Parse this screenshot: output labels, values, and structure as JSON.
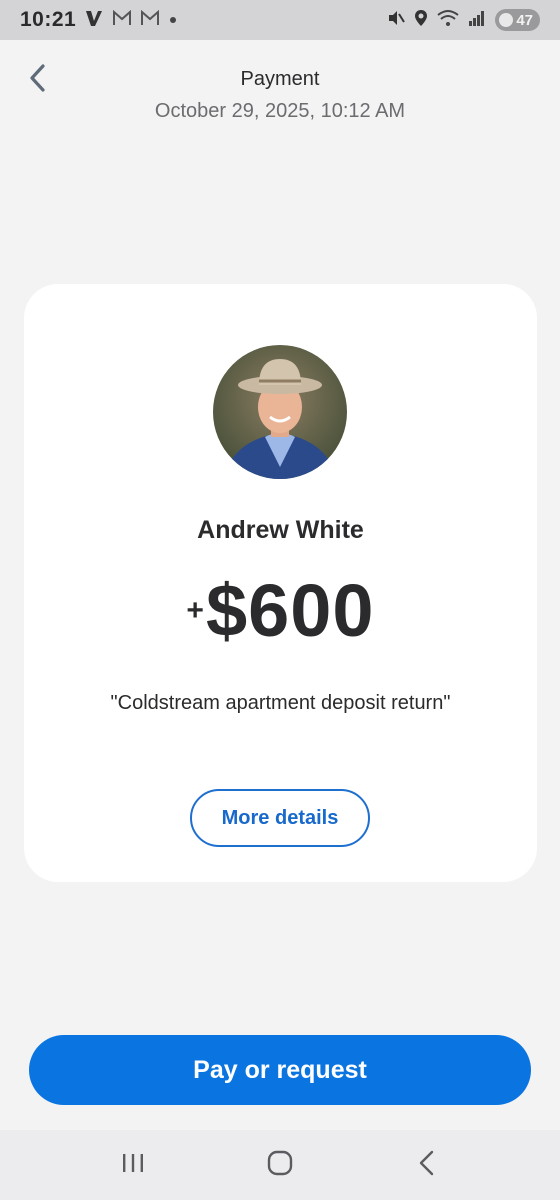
{
  "status_bar": {
    "time": "10:21",
    "app_icons": [
      "venmo-icon",
      "gmail-icon",
      "gmail-icon"
    ],
    "battery_level": "47"
  },
  "header": {
    "title": "Payment",
    "date": "October 29, 2025, 10:12 AM"
  },
  "payment": {
    "recipient_name": "Andrew White",
    "amount_sign": "+",
    "amount": "$600",
    "memo": "\"Coldstream apartment deposit return\"",
    "more_details_label": "More details"
  },
  "actions": {
    "pay_or_request_label": "Pay or request"
  },
  "colors": {
    "accent": "#0a74e0",
    "link": "#1769cc",
    "background": "#f3f3f4"
  }
}
